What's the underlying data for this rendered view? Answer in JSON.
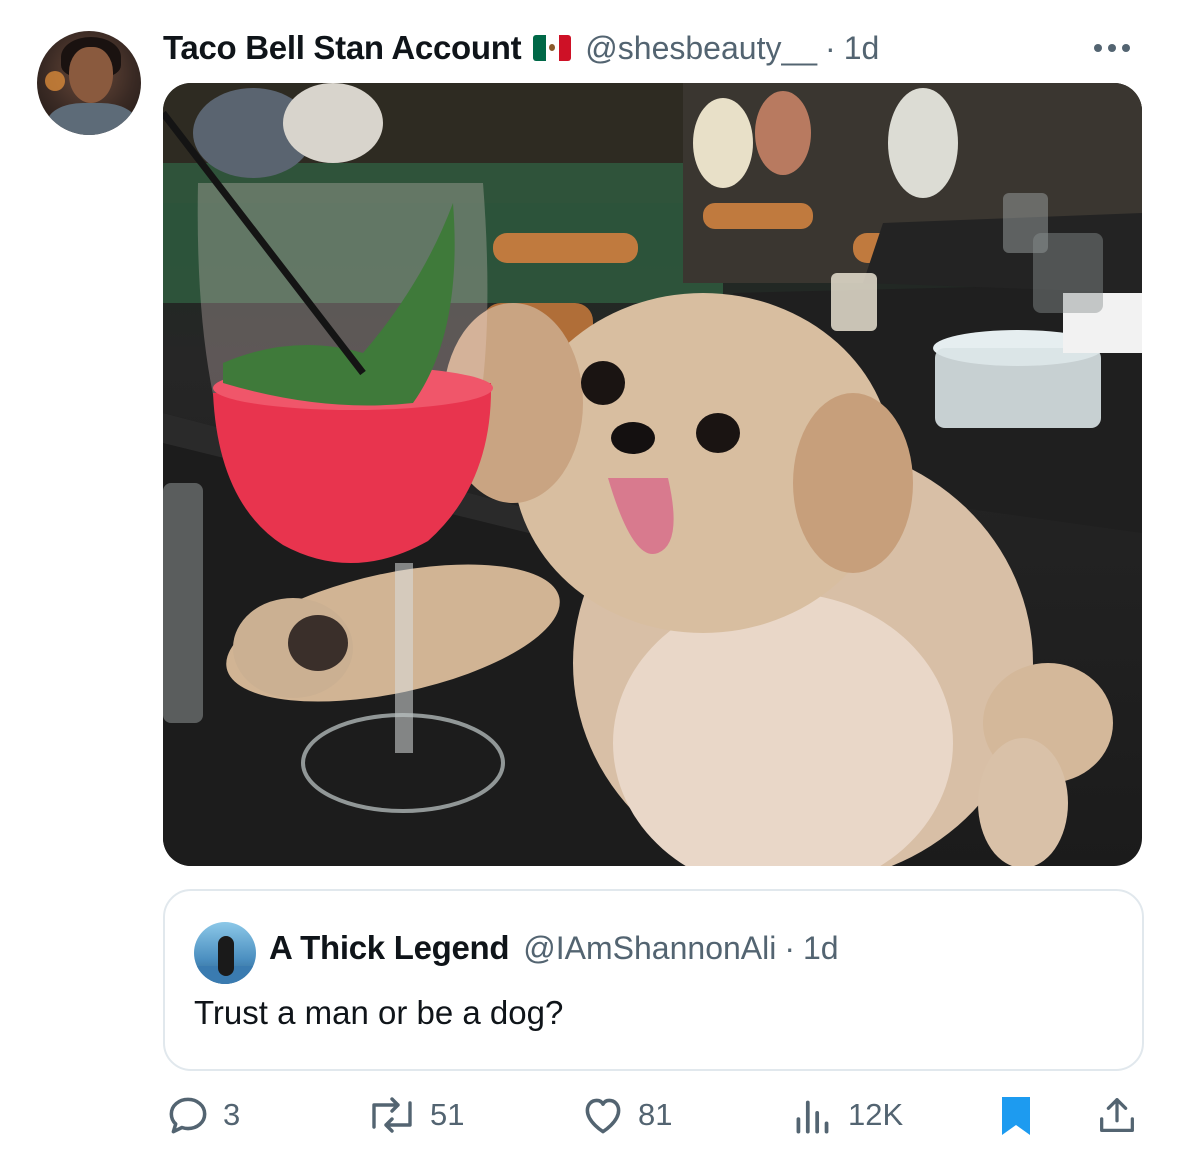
{
  "post": {
    "author_name": "Taco Bell Stan Account",
    "flag_icon": "mexico-flag-icon",
    "handle": "@shesbeauty__",
    "separator": "·",
    "time": "1d",
    "more_icon": "more-options-icon",
    "media_icon": "photo-dog-with-cocktail"
  },
  "quote": {
    "author_name": "A Thick Legend",
    "handle": "@IAmShannonAli",
    "separator": "·",
    "time": "1d",
    "text": "Trust a man or be a dog?"
  },
  "actions": {
    "reply": {
      "icon": "reply-icon",
      "count": "3"
    },
    "repost": {
      "icon": "repost-icon",
      "count": "51"
    },
    "like": {
      "icon": "like-icon",
      "count": "81"
    },
    "views": {
      "icon": "views-icon",
      "count": "12K"
    },
    "bookmark": {
      "icon": "bookmark-icon"
    },
    "share": {
      "icon": "share-icon"
    }
  },
  "colors": {
    "text_primary": "#0f1419",
    "text_secondary": "#536471",
    "bookmark_active": "#1d9bf0",
    "border": "#e1e8ed"
  }
}
